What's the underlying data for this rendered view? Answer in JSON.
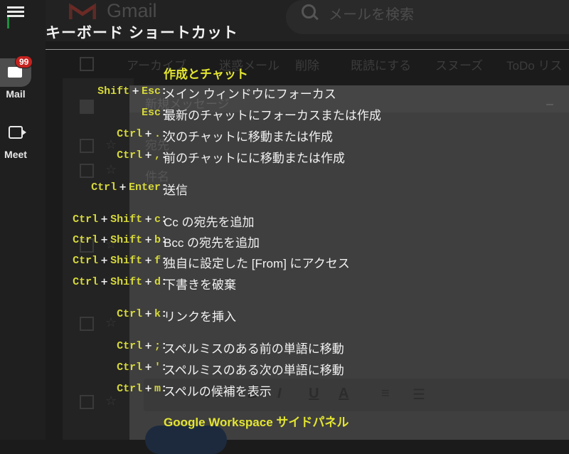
{
  "background": {
    "app_name": "Gmail",
    "search_placeholder": "メールを検索",
    "rail": {
      "mail_label": "Mail",
      "mail_badge": "99",
      "meet_label": "Meet"
    },
    "toolbar": [
      "アーカイブ",
      "迷惑メール",
      "削除",
      "既読にする",
      "スヌーズ",
      "ToDo リス"
    ],
    "compose": {
      "title": "新規メッセージ",
      "to_label": "宛先",
      "subject_label": "件名"
    }
  },
  "overlay": {
    "title": "キーボード ショートカット",
    "sections": [
      {
        "title": "作成とチャット",
        "shortcuts": [
          {
            "keys": [
              "Shift",
              "Esc"
            ],
            "desc": "メイン ウィンドウにフォーカス"
          },
          {
            "keys": [
              "Esc"
            ],
            "desc": "最新のチャットにフォーカスまたは作成"
          },
          {
            "keys": [
              "Ctrl",
              "."
            ],
            "desc": "次のチャットに移動または作成"
          },
          {
            "keys": [
              "Ctrl",
              ","
            ],
            "desc": "前のチャットにに移動または作成"
          },
          {
            "keys": [
              "Ctrl",
              "Enter"
            ],
            "desc": "送信"
          },
          {
            "keys": [
              "Ctrl",
              "Shift",
              "c"
            ],
            "desc": "Cc の宛先を追加"
          },
          {
            "keys": [
              "Ctrl",
              "Shift",
              "b"
            ],
            "desc": "Bcc の宛先を追加"
          },
          {
            "keys": [
              "Ctrl",
              "Shift",
              "f"
            ],
            "desc": "独自に設定した [From] にアクセス"
          },
          {
            "keys": [
              "Ctrl",
              "Shift",
              "d"
            ],
            "desc": "下書きを破棄"
          },
          {
            "keys": [
              "Ctrl",
              "k"
            ],
            "desc": "リンクを挿入"
          },
          {
            "keys": [
              "Ctrl",
              ";"
            ],
            "desc": "スペルミスのある前の単語に移動"
          },
          {
            "keys": [
              "Ctrl",
              "'"
            ],
            "desc": "スペルミスのある次の単語に移動"
          },
          {
            "keys": [
              "Ctrl",
              "m"
            ],
            "desc": "スペルの候補を表示"
          }
        ]
      },
      {
        "title": "Google Workspace サイドパネル",
        "shortcuts": []
      }
    ]
  },
  "colors": {
    "key": "#d6d83a",
    "section": "#e3e531",
    "badge": "#c5221f"
  }
}
